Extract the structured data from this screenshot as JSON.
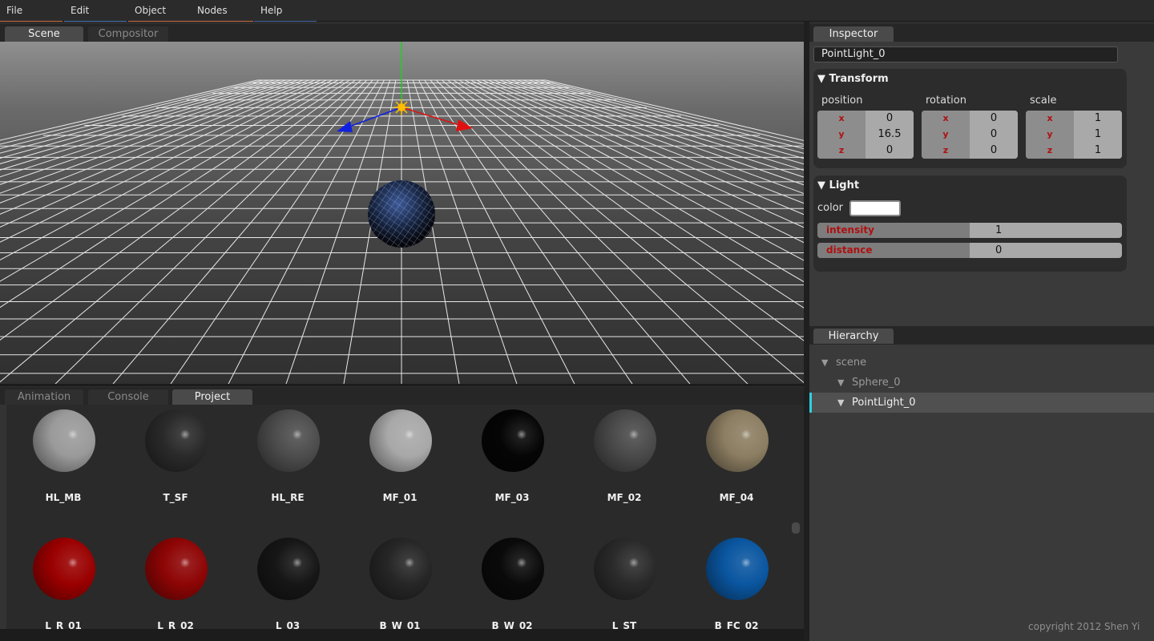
{
  "menu": [
    "File",
    "Edit",
    "Object",
    "Nodes",
    "Help"
  ],
  "menu_colors": [
    "#c8663a",
    "#3d6fb0",
    "#c8663a",
    "#c8663a",
    "#3d5fa0"
  ],
  "viewport_tabs": [
    "Scene",
    "Compositor"
  ],
  "bottom_tabs": [
    "Animation",
    "Console",
    "Project"
  ],
  "inspector": {
    "tab": "Inspector",
    "object_name": "PointLight_0",
    "transform": {
      "title": "Transform",
      "position": {
        "label": "position",
        "x": "0",
        "y": "16.5",
        "z": "0"
      },
      "rotation": {
        "label": "rotation",
        "x": "0",
        "y": "0",
        "z": "0"
      },
      "scale": {
        "label": "scale",
        "x": "1",
        "y": "1",
        "z": "1"
      }
    },
    "light": {
      "title": "Light",
      "color_label": "color",
      "color": "#ffffff",
      "intensity_label": "intensity",
      "intensity": "1",
      "distance_label": "distance",
      "distance": "0"
    }
  },
  "hierarchy": {
    "tab": "Hierarchy",
    "nodes": [
      "scene",
      "Sphere_0",
      "PointLight_0"
    ],
    "selected": "PointLight_0"
  },
  "materials": [
    {
      "name": "HL_MB",
      "color": "#9a9a9a"
    },
    {
      "name": "T_SF",
      "color": "#2a2a2a"
    },
    {
      "name": "HL_RE",
      "color": "#4d4d4d"
    },
    {
      "name": "MF_01",
      "color": "#a8a8a8"
    },
    {
      "name": "MF_03",
      "color": "#050505"
    },
    {
      "name": "MF_02",
      "color": "#4a4a4a"
    },
    {
      "name": "MF_04",
      "color": "#8c7e62"
    },
    {
      "name": "L_R_01",
      "color": "#9a0000"
    },
    {
      "name": "L_R_02",
      "color": "#8e0505"
    },
    {
      "name": "L_03",
      "color": "#161616"
    },
    {
      "name": "B_W_01",
      "color": "#262626"
    },
    {
      "name": "B_W_02",
      "color": "#0a0a0a"
    },
    {
      "name": "L_ST",
      "color": "#2a2a2a"
    },
    {
      "name": "B_FC_02",
      "color": "#0a56a0"
    }
  ],
  "copyright": "copyright 2012 Shen Yi"
}
